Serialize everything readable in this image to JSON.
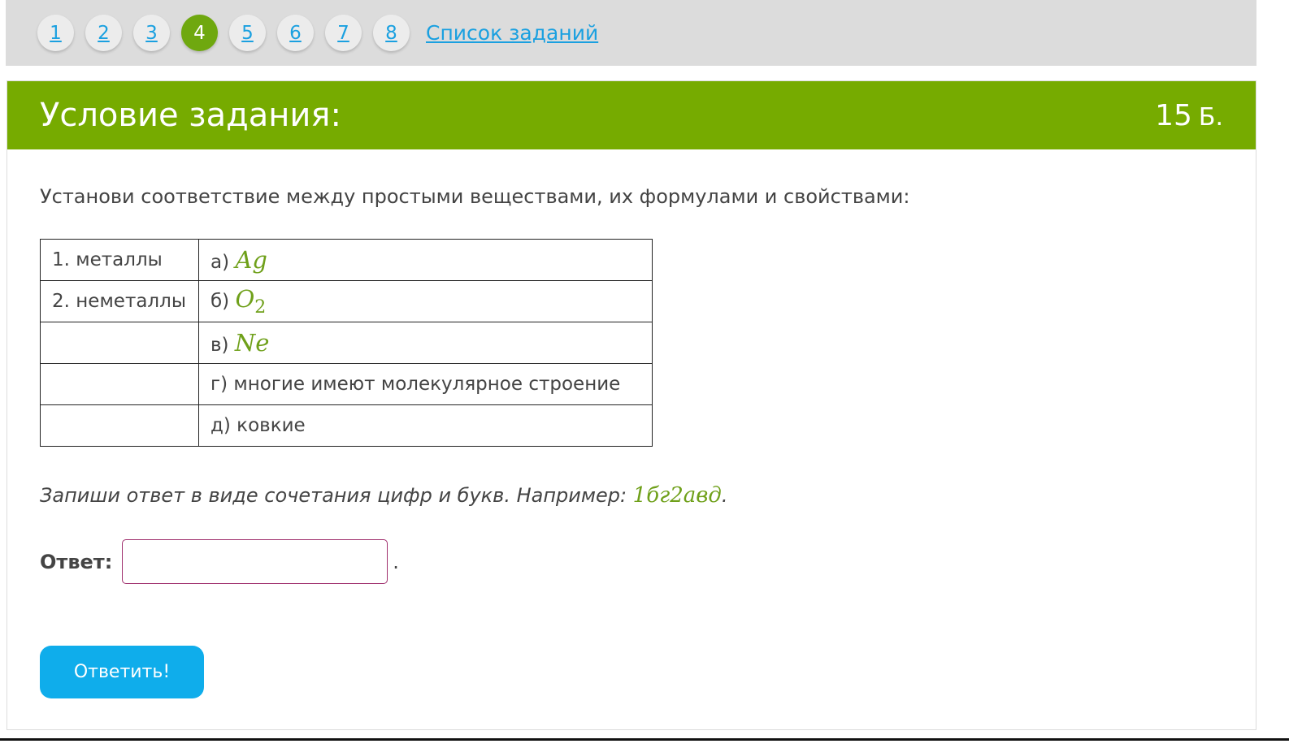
{
  "nav": {
    "numbers": [
      "1",
      "2",
      "3",
      "4",
      "5",
      "6",
      "7",
      "8"
    ],
    "active_index": 3,
    "task_list_label": "Список заданий"
  },
  "header": {
    "title": "Условие задания:",
    "score_value": "15",
    "score_unit": "Б."
  },
  "question": "Установи соответствие между простыми веществами, их формулами и свойствами:",
  "table": {
    "left": [
      "1. металлы",
      "2. неметаллы",
      "",
      "",
      ""
    ],
    "right_prefix": [
      "а)",
      "б)",
      "в)",
      "г) многие имеют молекулярное строение",
      "д) ковкие"
    ],
    "formulas": {
      "a": "Ag",
      "b_main": "O",
      "b_sub": "2",
      "c": "Ne"
    }
  },
  "hint": {
    "text": "Запиши ответ в виде сочетания цифр и букв. Например: ",
    "example": "1бг2авд",
    "end": "."
  },
  "answer": {
    "label": "Ответ:",
    "value": "",
    "placeholder": "",
    "dot": "."
  },
  "submit_label": "Ответить!",
  "colors": {
    "header_green": "#76ab00",
    "active_green": "#6fa80f",
    "link_blue": "#1aa0e0",
    "button_blue": "#0fadeb",
    "formula_green": "#6fa01a"
  }
}
